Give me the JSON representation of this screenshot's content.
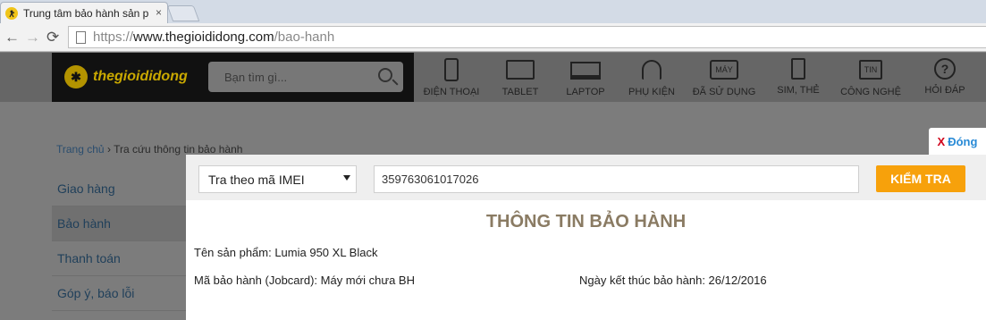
{
  "browser": {
    "tab_title": "Trung tâm bảo hành sản p",
    "tab_close": "×",
    "url_scheme": "https://",
    "url_host": "www.thegioididong.com",
    "url_path": "/bao-hanh",
    "back_glyph": "←",
    "forward_glyph": "→",
    "reload_glyph": "⟳"
  },
  "site": {
    "logo_text": "thegioididong",
    "search_placeholder": "Bạn tìm gì...",
    "nav": [
      {
        "label": "ĐIỆN THOẠI",
        "icon": "phone-icon"
      },
      {
        "label": "TABLET",
        "icon": "tablet-icon"
      },
      {
        "label": "LAPTOP",
        "icon": "laptop-icon"
      },
      {
        "label": "PHỤ KIỆN",
        "icon": "headphones-icon"
      },
      {
        "label": "ĐÃ SỬ DỤNG",
        "icon": "used-device-icon",
        "icon_text": "MÁY"
      },
      {
        "label": "SIM, THẺ",
        "icon": "sim-icon"
      },
      {
        "label": "CÔNG NGHỆ",
        "icon": "news-icon",
        "icon_text": "TIN"
      },
      {
        "label": "HỎI ĐÁP",
        "icon": "question-icon",
        "icon_text": "?"
      }
    ],
    "breadcrumb": {
      "home": "Trang chủ",
      "separator": "›",
      "current": "Tra cứu thông tin bảo hành"
    },
    "sidebar": [
      "Giao hàng",
      "Bảo hành",
      "Thanh toán",
      "Góp ý, báo lỗi"
    ]
  },
  "modal": {
    "close_x": "X",
    "close_label": "Đóng",
    "lookup_select": "Tra theo mã IMEI",
    "imei_value": "359763061017026",
    "check_button": "KIỂM TRA",
    "title": "THÔNG TIN BẢO HÀNH",
    "product": "Tên sản phẩm: Lumia 950 XL Black",
    "jobcard": "Mã bảo hành (Jobcard): Máy mới chưa BH",
    "end_date": "Ngày kết thúc bảo hành: 26/12/2016"
  },
  "colors": {
    "accent": "#f7a10b",
    "title": "#8a7b63",
    "close": "#d0021b",
    "link": "#288ad6"
  }
}
